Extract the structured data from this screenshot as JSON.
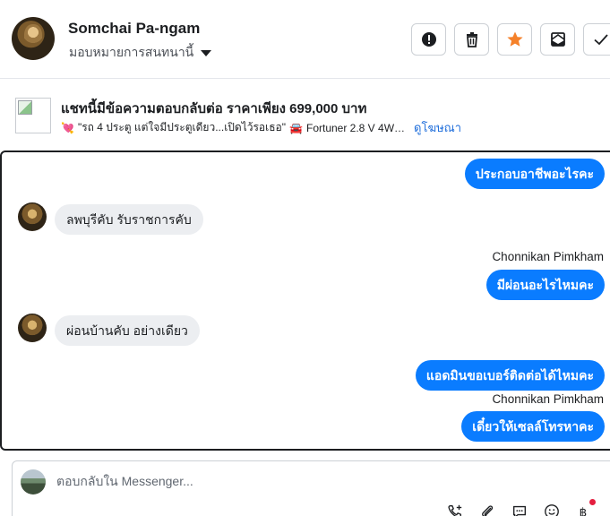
{
  "header": {
    "name": "Somchai Pa-ngam",
    "assign_label": "มอบหมายการสนทนานี้",
    "buttons": [
      "report-icon",
      "trash-icon",
      "star-icon",
      "mail-icon",
      "check-icon"
    ],
    "star_color": "#f5812a"
  },
  "ad": {
    "title": "แชทนี้มีข้อความตอบกลับต่อ ราคาเพียง 699,000 บาท",
    "subtitle": "\"รถ 4 ประตู แต่ใจมีประตูเดียว...เปิดไว้รอเธอ\"",
    "car_text": "Fortuner 2.8 V 4W…",
    "link": "ดูโฆษณา"
  },
  "conversation": {
    "messages": [
      {
        "direction": "out",
        "text": "ประกอบอาชีพอะไรคะ"
      },
      {
        "direction": "in",
        "text": "ลพบุรีคับ รับราชการคับ"
      },
      {
        "direction": "out",
        "sender": "Chonnikan Pimkham",
        "text": "มีผ่อนอะไรไหมคะ"
      },
      {
        "direction": "in",
        "text": "ผ่อนบ้านคับ อย่างเดียว"
      },
      {
        "direction": "out",
        "text": "แอดมินขอเบอร์ติดต่อได้ไหมคะ"
      },
      {
        "direction": "out",
        "sender": "Chonnikan Pimkham",
        "text": "เดี๋ยวให้เซลล์โทรหาคะ"
      }
    ],
    "accent": "#0a7cff"
  },
  "composer": {
    "placeholder": "ตอบกลับใน Messenger...",
    "tools": [
      "call-add-icon",
      "attachment-icon",
      "saved-replies-icon",
      "emoji-icon",
      "payment-icon"
    ]
  }
}
